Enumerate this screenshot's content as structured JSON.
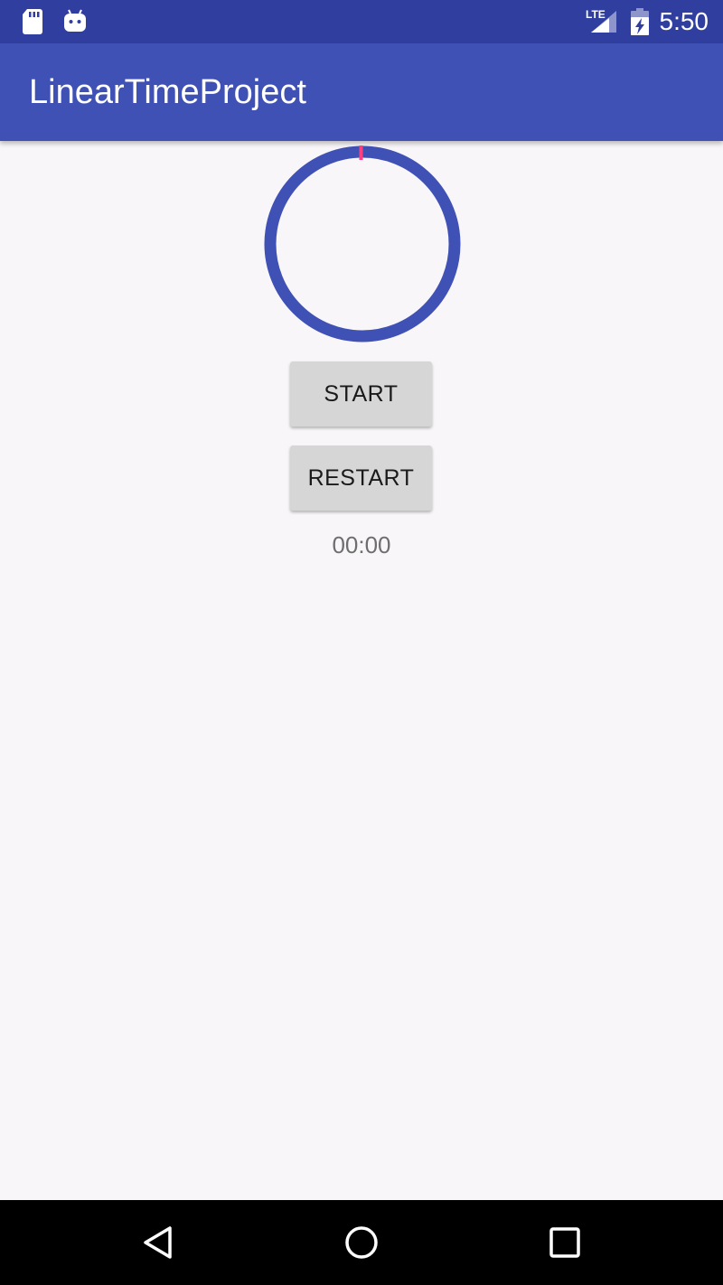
{
  "status_bar": {
    "network": "LTE",
    "time": "5:50",
    "icons": [
      "sd-card-icon",
      "android-icon",
      "signal-icon",
      "battery-icon"
    ]
  },
  "app_bar": {
    "title": "LinearTimeProject"
  },
  "timer": {
    "progress": 0,
    "ring_color": "#3f51b5",
    "marker_color": "#ff4081"
  },
  "buttons": {
    "start_label": "START",
    "restart_label": "RESTART"
  },
  "time_display": "00:00",
  "nav_bar": {
    "icons": [
      "back-icon",
      "home-icon",
      "recents-icon"
    ]
  },
  "colors": {
    "primary_dark": "#303f9f",
    "primary": "#3f51b5",
    "accent": "#ff4081",
    "background": "#f8f6f8"
  }
}
